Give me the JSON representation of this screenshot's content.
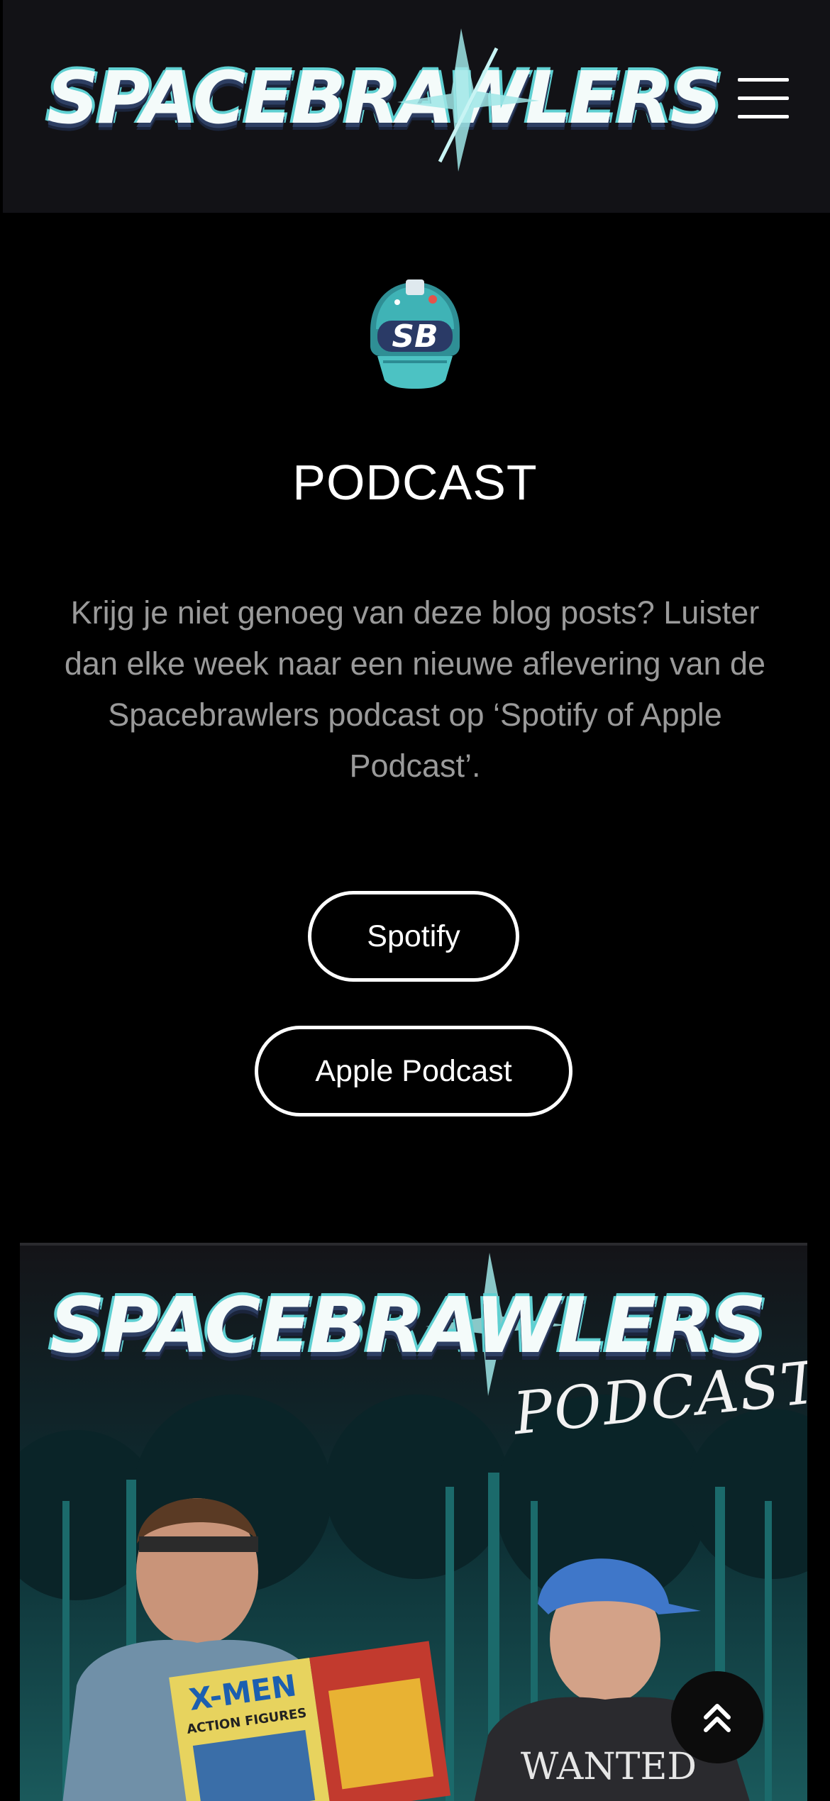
{
  "header": {
    "brand": "SPACEBRAWLERS",
    "menu_icon": "hamburger-menu-icon"
  },
  "badge_icon": "sb-helmet-logo-icon",
  "badge_text": "SB",
  "section": {
    "title": "PODCAST",
    "description": "Krijg je niet genoeg van deze blog posts? Luister dan elke week naar een nieuwe aflevering van de Spacebrawlers podcast op ‘Spotify of Apple Podcast’."
  },
  "buttons": {
    "spotify": "Spotify",
    "apple": "Apple Podcast"
  },
  "cover": {
    "brand": "SPACEBRAWLERS",
    "subtitle": "PODCAST",
    "comic_title": "X-MEN",
    "comic_subtitle": "ACTION FIGURES",
    "shirt_text": "WANTED"
  },
  "scroll_top_icon": "double-chevron-up-icon",
  "scroll_top_glyph": "»"
}
